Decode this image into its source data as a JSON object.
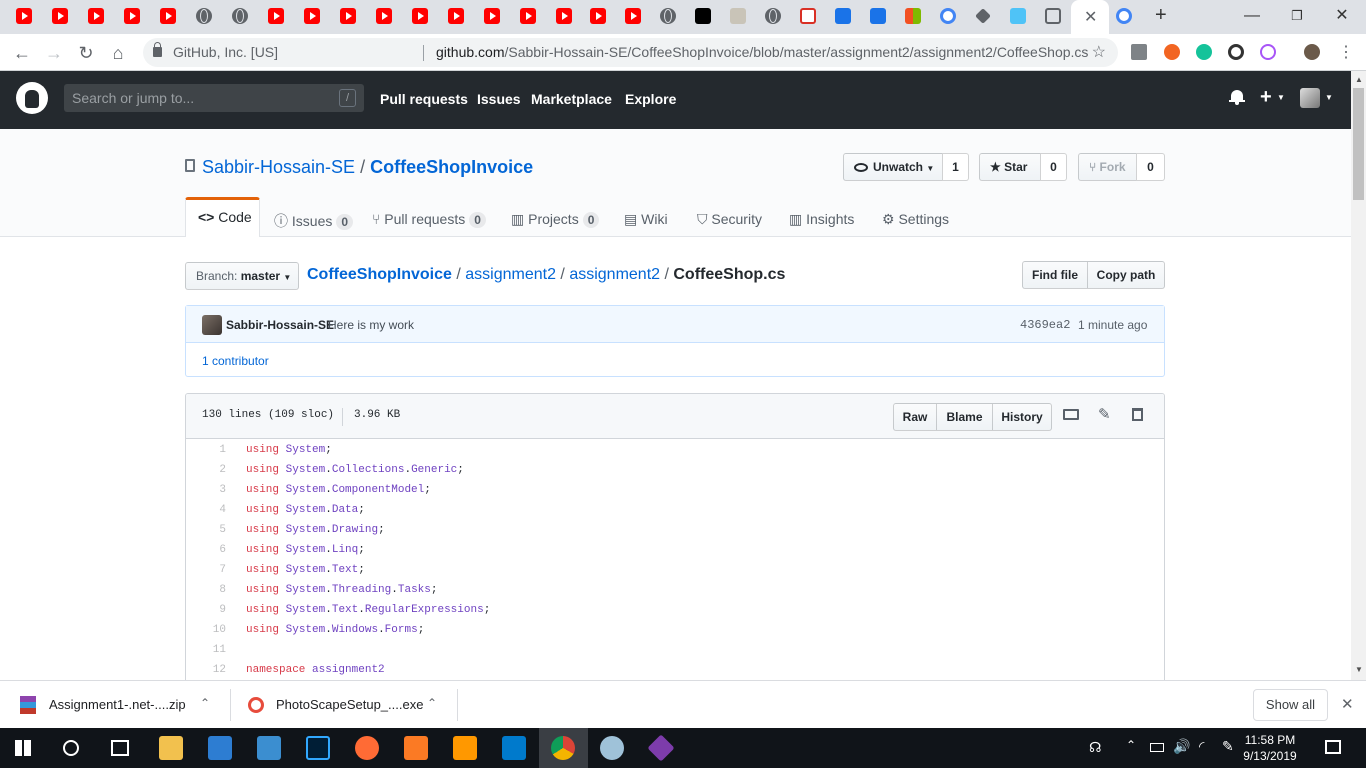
{
  "browser": {
    "omnibox": {
      "org": "GitHub, Inc. [US]",
      "url_host": "github.com",
      "url_path": "/Sabbir-Hossain-SE/CoffeeShopInvoice/blob/master/assignment2/assignment2/CoffeeShop.cs"
    }
  },
  "github": {
    "search_placeholder": "Search or jump to...",
    "search_shortcut": "/",
    "nav": [
      "Pull requests",
      "Issues",
      "Marketplace",
      "Explore"
    ]
  },
  "repo": {
    "owner": "Sabbir-Hossain-SE",
    "separator": "/",
    "name": "CoffeeShopInvoice",
    "unwatch_label": "Unwatch",
    "unwatch_count": "1",
    "star_label": "Star",
    "star_count": "0",
    "fork_label": "Fork",
    "fork_count": "0",
    "tabs": {
      "code": "Code",
      "issues": "Issues",
      "issues_count": "0",
      "pulls": "Pull requests",
      "pulls_count": "0",
      "projects": "Projects",
      "projects_count": "0",
      "wiki": "Wiki",
      "security": "Security",
      "insights": "Insights",
      "settings": "Settings"
    }
  },
  "file_nav": {
    "branch_prefix": "Branch:",
    "branch": "master",
    "crumbs": [
      "CoffeeShopInvoice",
      "assignment2",
      "assignment2"
    ],
    "file": "CoffeeShop.cs",
    "find_file": "Find file",
    "copy_path": "Copy path"
  },
  "commit": {
    "author": "Sabbir-Hossain-SE",
    "message": "Here is my work",
    "sha": "4369ea2",
    "time": "1 minute ago",
    "contributors": "1 contributor"
  },
  "blob": {
    "info_lines": "130 lines (109 sloc)",
    "info_size": "3.96 KB",
    "raw": "Raw",
    "blame": "Blame",
    "history": "History",
    "lines": [
      {
        "n": "1",
        "kw": "using",
        "ns": [
          "System"
        ],
        "end": ";"
      },
      {
        "n": "2",
        "kw": "using",
        "ns": [
          "System",
          "Collections",
          "Generic"
        ],
        "end": ";"
      },
      {
        "n": "3",
        "kw": "using",
        "ns": [
          "System",
          "ComponentModel"
        ],
        "end": ";"
      },
      {
        "n": "4",
        "kw": "using",
        "ns": [
          "System",
          "Data"
        ],
        "end": ";"
      },
      {
        "n": "5",
        "kw": "using",
        "ns": [
          "System",
          "Drawing"
        ],
        "end": ";"
      },
      {
        "n": "6",
        "kw": "using",
        "ns": [
          "System",
          "Linq"
        ],
        "end": ";"
      },
      {
        "n": "7",
        "kw": "using",
        "ns": [
          "System",
          "Text"
        ],
        "end": ";"
      },
      {
        "n": "8",
        "kw": "using",
        "ns": [
          "System",
          "Threading",
          "Tasks"
        ],
        "end": ";"
      },
      {
        "n": "9",
        "kw": "using",
        "ns": [
          "System",
          "Text",
          "RegularExpressions"
        ],
        "end": ";"
      },
      {
        "n": "10",
        "kw": "using",
        "ns": [
          "System",
          "Windows",
          "Forms"
        ],
        "end": ";"
      },
      {
        "n": "11",
        "kw": "",
        "ns": [],
        "end": ""
      },
      {
        "n": "12",
        "kw": "namespace",
        "ns": [
          "assignment2"
        ],
        "end": ""
      }
    ]
  },
  "downloads": {
    "items": [
      "Assignment1-.net-....zip",
      "PhotoScapeSetup_....exe"
    ],
    "show_all": "Show all"
  },
  "taskbar": {
    "time": "11:58 PM",
    "date": "9/13/2019"
  },
  "colors": {
    "header": "#24292e",
    "link": "#0366d6",
    "accent_tab": "#e36209",
    "keyword": "#d73a49",
    "entity": "#6f42c1"
  }
}
